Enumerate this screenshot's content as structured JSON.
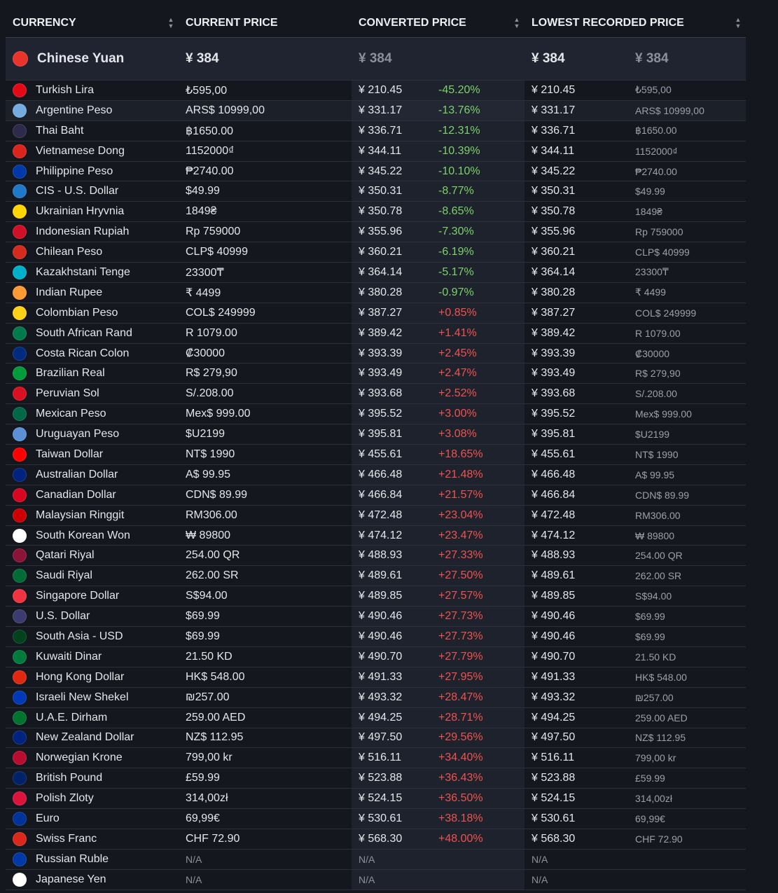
{
  "headers": {
    "currency": "CURRENCY",
    "current_price": "CURRENT PRICE",
    "converted_price": "CONVERTED PRICE",
    "lowest_recorded_price": "LOWEST RECORDED PRICE"
  },
  "base": {
    "currency": "Chinese Yuan",
    "current_price": "¥ 384",
    "converted_price": "¥ 384",
    "lowest_price": "¥ 384",
    "lowest_original": "¥ 384",
    "flag_icon": "china-flag-icon",
    "flag_color": "#e8342b"
  },
  "rows": [
    {
      "currency": "Turkish Lira",
      "price": "₺595,00",
      "conv": "¥ 210.45",
      "pct": "-45.20%",
      "low": "¥ 210.45",
      "lowo": "₺595,00",
      "flag": "#e30a17"
    },
    {
      "currency": "Argentine Peso",
      "price": "ARS$ 10999,00",
      "conv": "¥ 331.17",
      "pct": "-13.76%",
      "low": "¥ 331.17",
      "lowo": "ARS$ 10999,00",
      "flag": "#74acdf"
    },
    {
      "currency": "Thai Baht",
      "price": "฿1650.00",
      "conv": "¥ 336.71",
      "pct": "-12.31%",
      "low": "¥ 336.71",
      "lowo": "฿1650.00",
      "flag": "#2d2a4a"
    },
    {
      "currency": "Vietnamese Dong",
      "price": "1152000₫",
      "conv": "¥ 344.11",
      "pct": "-10.39%",
      "low": "¥ 344.11",
      "lowo": "1152000₫",
      "flag": "#da251d"
    },
    {
      "currency": "Philippine Peso",
      "price": "₱2740.00",
      "conv": "¥ 345.22",
      "pct": "-10.10%",
      "low": "¥ 345.22",
      "lowo": "₱2740.00",
      "flag": "#0038a8"
    },
    {
      "currency": "CIS - U.S. Dollar",
      "price": "$49.99",
      "conv": "¥ 350.31",
      "pct": "-8.77%",
      "low": "¥ 350.31",
      "lowo": "$49.99",
      "flag": "#1f78c8"
    },
    {
      "currency": "Ukrainian Hryvnia",
      "price": "1849₴",
      "conv": "¥ 350.78",
      "pct": "-8.65%",
      "low": "¥ 350.78",
      "lowo": "1849₴",
      "flag": "#ffd500"
    },
    {
      "currency": "Indonesian Rupiah",
      "price": "Rp 759000",
      "conv": "¥ 355.96",
      "pct": "-7.30%",
      "low": "¥ 355.96",
      "lowo": "Rp 759000",
      "flag": "#ce1126"
    },
    {
      "currency": "Chilean Peso",
      "price": "CLP$ 40999",
      "conv": "¥ 360.21",
      "pct": "-6.19%",
      "low": "¥ 360.21",
      "lowo": "CLP$ 40999",
      "flag": "#d52b1e"
    },
    {
      "currency": "Kazakhstani Tenge",
      "price": "23300₸",
      "conv": "¥ 364.14",
      "pct": "-5.17%",
      "low": "¥ 364.14",
      "lowo": "23300₸",
      "flag": "#00afca"
    },
    {
      "currency": "Indian Rupee",
      "price": "₹ 4499",
      "conv": "¥ 380.28",
      "pct": "-0.97%",
      "low": "¥ 380.28",
      "lowo": "₹ 4499",
      "flag": "#ff9933"
    },
    {
      "currency": "Colombian Peso",
      "price": "COL$ 249999",
      "conv": "¥ 387.27",
      "pct": "+0.85%",
      "low": "¥ 387.27",
      "lowo": "COL$ 249999",
      "flag": "#fcd116"
    },
    {
      "currency": "South African Rand",
      "price": "R 1079.00",
      "conv": "¥ 389.42",
      "pct": "+1.41%",
      "low": "¥ 389.42",
      "lowo": "R 1079.00",
      "flag": "#007a4d"
    },
    {
      "currency": "Costa Rican Colon",
      "price": "₡30000",
      "conv": "¥ 393.39",
      "pct": "+2.45%",
      "low": "¥ 393.39",
      "lowo": "₡30000",
      "flag": "#002b7f"
    },
    {
      "currency": "Brazilian Real",
      "price": "R$ 279,90",
      "conv": "¥ 393.49",
      "pct": "+2.47%",
      "low": "¥ 393.49",
      "lowo": "R$ 279,90",
      "flag": "#009c3b"
    },
    {
      "currency": "Peruvian Sol",
      "price": "S/.208.00",
      "conv": "¥ 393.68",
      "pct": "+2.52%",
      "low": "¥ 393.68",
      "lowo": "S/.208.00",
      "flag": "#d91023"
    },
    {
      "currency": "Mexican Peso",
      "price": "Mex$ 999.00",
      "conv": "¥ 395.52",
      "pct": "+3.00%",
      "low": "¥ 395.52",
      "lowo": "Mex$ 999.00",
      "flag": "#006847"
    },
    {
      "currency": "Uruguayan Peso",
      "price": "$U2199",
      "conv": "¥ 395.81",
      "pct": "+3.08%",
      "low": "¥ 395.81",
      "lowo": "$U2199",
      "flag": "#5b8fd6"
    },
    {
      "currency": "Taiwan Dollar",
      "price": "NT$ 1990",
      "conv": "¥ 455.61",
      "pct": "+18.65%",
      "low": "¥ 455.61",
      "lowo": "NT$ 1990",
      "flag": "#fe0000"
    },
    {
      "currency": "Australian Dollar",
      "price": "A$ 99.95",
      "conv": "¥ 466.48",
      "pct": "+21.48%",
      "low": "¥ 466.48",
      "lowo": "A$ 99.95",
      "flag": "#00247d"
    },
    {
      "currency": "Canadian Dollar",
      "price": "CDN$ 89.99",
      "conv": "¥ 466.84",
      "pct": "+21.57%",
      "low": "¥ 466.84",
      "lowo": "CDN$ 89.99",
      "flag": "#d80621"
    },
    {
      "currency": "Malaysian Ringgit",
      "price": "RM306.00",
      "conv": "¥ 472.48",
      "pct": "+23.04%",
      "low": "¥ 472.48",
      "lowo": "RM306.00",
      "flag": "#cc0001"
    },
    {
      "currency": "South Korean Won",
      "price": "₩ 89800",
      "conv": "¥ 474.12",
      "pct": "+23.47%",
      "low": "¥ 474.12",
      "lowo": "₩ 89800",
      "flag": "#ffffff"
    },
    {
      "currency": "Qatari Riyal",
      "price": "254.00 QR",
      "conv": "¥ 488.93",
      "pct": "+27.33%",
      "low": "¥ 488.93",
      "lowo": "254.00 QR",
      "flag": "#8a1538"
    },
    {
      "currency": "Saudi Riyal",
      "price": "262.00 SR",
      "conv": "¥ 489.61",
      "pct": "+27.50%",
      "low": "¥ 489.61",
      "lowo": "262.00 SR",
      "flag": "#006c35"
    },
    {
      "currency": "Singapore Dollar",
      "price": "S$94.00",
      "conv": "¥ 489.85",
      "pct": "+27.57%",
      "low": "¥ 489.85",
      "lowo": "S$94.00",
      "flag": "#ef3340"
    },
    {
      "currency": "U.S. Dollar",
      "price": "$69.99",
      "conv": "¥ 490.46",
      "pct": "+27.73%",
      "low": "¥ 490.46",
      "lowo": "$69.99",
      "flag": "#3c3b6e"
    },
    {
      "currency": "South Asia - USD",
      "price": "$69.99",
      "conv": "¥ 490.46",
      "pct": "+27.73%",
      "low": "¥ 490.46",
      "lowo": "$69.99",
      "flag": "#01411c"
    },
    {
      "currency": "Kuwaiti Dinar",
      "price": "21.50 KD",
      "conv": "¥ 490.70",
      "pct": "+27.79%",
      "low": "¥ 490.70",
      "lowo": "21.50 KD",
      "flag": "#007a3d"
    },
    {
      "currency": "Hong Kong Dollar",
      "price": "HK$ 548.00",
      "conv": "¥ 491.33",
      "pct": "+27.95%",
      "low": "¥ 491.33",
      "lowo": "HK$ 548.00",
      "flag": "#de2910"
    },
    {
      "currency": "Israeli New Shekel",
      "price": "₪257.00",
      "conv": "¥ 493.32",
      "pct": "+28.47%",
      "low": "¥ 493.32",
      "lowo": "₪257.00",
      "flag": "#0038b8"
    },
    {
      "currency": "U.A.E. Dirham",
      "price": "259.00 AED",
      "conv": "¥ 494.25",
      "pct": "+28.71%",
      "low": "¥ 494.25",
      "lowo": "259.00 AED",
      "flag": "#00732f"
    },
    {
      "currency": "New Zealand Dollar",
      "price": "NZ$ 112.95",
      "conv": "¥ 497.50",
      "pct": "+29.56%",
      "low": "¥ 497.50",
      "lowo": "NZ$ 112.95",
      "flag": "#00247d"
    },
    {
      "currency": "Norwegian Krone",
      "price": "799,00 kr",
      "conv": "¥ 516.11",
      "pct": "+34.40%",
      "low": "¥ 516.11",
      "lowo": "799,00 kr",
      "flag": "#ba0c2f"
    },
    {
      "currency": "British Pound",
      "price": "£59.99",
      "conv": "¥ 523.88",
      "pct": "+36.43%",
      "low": "¥ 523.88",
      "lowo": "£59.99",
      "flag": "#012169"
    },
    {
      "currency": "Polish Zloty",
      "price": "314,00zł",
      "conv": "¥ 524.15",
      "pct": "+36.50%",
      "low": "¥ 524.15",
      "lowo": "314,00zł",
      "flag": "#dc143c"
    },
    {
      "currency": "Euro",
      "price": "69,99€",
      "conv": "¥ 530.61",
      "pct": "+38.18%",
      "low": "¥ 530.61",
      "lowo": "69,99€",
      "flag": "#003399"
    },
    {
      "currency": "Swiss Franc",
      "price": "CHF 72.90",
      "conv": "¥ 568.30",
      "pct": "+48.00%",
      "low": "¥ 568.30",
      "lowo": "CHF 72.90",
      "flag": "#da291c"
    },
    {
      "currency": "Russian Ruble",
      "price": "N/A",
      "conv": "N/A",
      "pct": "",
      "low": "N/A",
      "lowo": "",
      "flag": "#0039a6"
    },
    {
      "currency": "Japanese Yen",
      "price": "N/A",
      "conv": "N/A",
      "pct": "",
      "low": "N/A",
      "lowo": "",
      "flag": "#ffffff"
    }
  ],
  "colors": {
    "negative": "#7cd36a",
    "positive": "#ef5350"
  }
}
